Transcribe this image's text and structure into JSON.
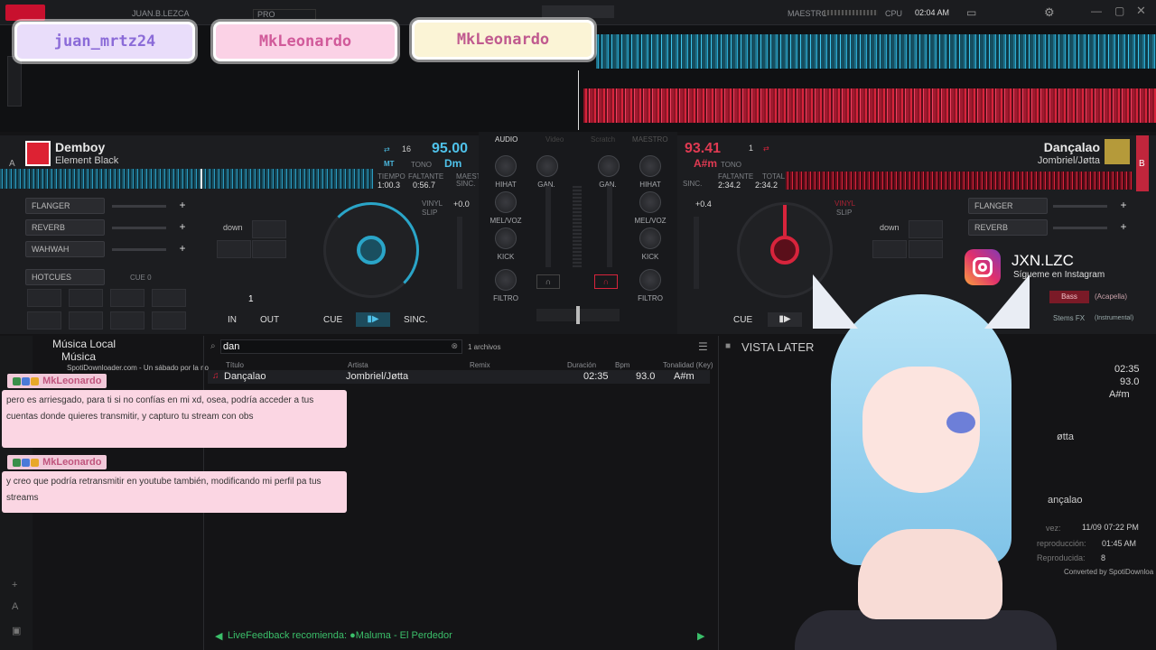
{
  "topbar": {
    "user": "JUAN.B.LEZCA",
    "plan": "PRO",
    "master_label": "MAESTRO",
    "cpu_label": "CPU",
    "time": "02:04 AM"
  },
  "name_tags": [
    "juan_mrtz24",
    "MkLeonardo",
    "MkLeonardo"
  ],
  "deck_a": {
    "letter": "A",
    "title": "Demboy",
    "artist": "Element Black",
    "key_num": "16",
    "bpm": "95.00",
    "mt": "MT",
    "tono": "TONO",
    "key": "Dm",
    "tiempo_label": "TIEMPO",
    "faltante_label": "FALTANTE",
    "maestro_label": "MAESTRO",
    "sinc_label": "SINC.",
    "tiempo": "1:00.3",
    "faltante": "0:56.7",
    "fx": [
      "FLANGER",
      "REVERB",
      "WAHWAH"
    ],
    "hotcues": "HOTCUES",
    "cue_label": "CUE 0",
    "pitch": "+0.0",
    "loop_down": "down",
    "loop_num": "1",
    "in": "IN",
    "out": "OUT",
    "cue": "CUE",
    "sinc": "SINC.",
    "vinyl": "VINYL",
    "slip": "SLIP"
  },
  "deck_b": {
    "letter": "B",
    "title": "Dançalao",
    "artist": "Jombriel/Jøtta",
    "bpm": "93.41",
    "key_num": "1",
    "key": "A#m",
    "tono": "TONO",
    "faltante_label": "FALTANTE",
    "total_label": "TOTAL",
    "sinc_label": "SINC.",
    "faltante": "2:34.2",
    "total": "2:34.2",
    "fx": [
      "FLANGER",
      "REVERB"
    ],
    "pitch": "+0.4",
    "loop_down": "down",
    "cue": "CUE",
    "vinyl": "VINYL",
    "slip": "SLIP"
  },
  "mixer": {
    "tabs": [
      "AUDIO",
      "Video",
      "Scratch",
      "MAESTRO"
    ],
    "gan": "GAN.",
    "hihat": "HIHAT",
    "melvoz": "MEL/VOZ",
    "kick": "KICK",
    "filtro": "FILTRO"
  },
  "browser": {
    "tree": [
      "Música Local",
      "Música",
      "SpotiDownloader.com - Un sábado por la no"
    ],
    "search": "dan",
    "count": "1 archivos",
    "columns": [
      "Título",
      "Artista",
      "Remix",
      "Duración",
      "Bpm",
      "Tonalidad (Key)"
    ],
    "row": {
      "title": "Dançalao",
      "artist": "Jombriel/Jøtta",
      "duration": "02:35",
      "bpm": "93.0",
      "key": "A#m"
    },
    "livefeed": "LiveFeedback recomienda: ●Maluma - El Perdedor"
  },
  "side": {
    "title": "VISTA LATER",
    "duration": "02:35",
    "bpm": "93.0",
    "key": "A#m",
    "artist_frag": "øtta",
    "title_frag": "ançalao",
    "vez": "vez:",
    "date": "11/09 07:22 PM",
    "repro_label": "reproducción:",
    "repro_time": "01:45 AM",
    "reprod_label": "Reproducida:",
    "reprod_count": "8",
    "converted": "Converted by SpotiDownloa"
  },
  "stems": {
    "bass": "Bass",
    "acapella": "(Acapella)",
    "stems_fx": "Stems FX",
    "instrumental": "(Instrumental)"
  },
  "instagram": {
    "handle": "JXN.LZC",
    "sub": "Sígueme en Instagram"
  },
  "chat": [
    {
      "name": "MkLeonardo",
      "msg": "pero es arriesgado, para ti si no confías en mi xd, osea, podría acceder a tus cuentas donde quieres transmitir, y capturo tu stream con obs"
    },
    {
      "name": "MkLeonardo",
      "msg": "y creo que podría retransmitir en youtube también, modificando mi perfil pa tus streams"
    }
  ],
  "colors": {
    "deck_a": "#2aa5c8",
    "deck_b": "#d8243c",
    "chat_bg": "#fbd6e3"
  }
}
